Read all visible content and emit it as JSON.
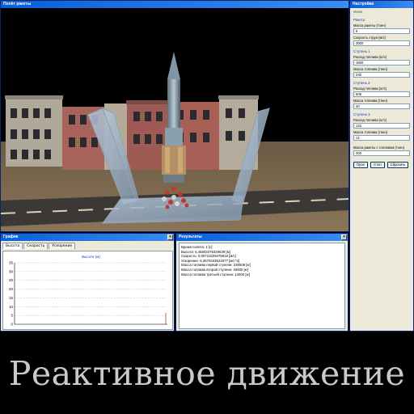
{
  "main_window": {
    "title": "Полёт ракеты"
  },
  "settings": {
    "title": "Настройки",
    "tab_label": "Меню",
    "rocket": {
      "group_title": "Ракета",
      "mass_label": "Масса ракеты (тонн)",
      "mass_value": "6",
      "exhaust_label": "Скорость струи (м/с)",
      "exhaust_value": "3000"
    },
    "stage1": {
      "group_title": "Ступень 1",
      "fuel_rate_label": "Расход топлива (кг/с)",
      "fuel_rate_value": "1600",
      "fuel_mass_label": "Масса топлива (тонн)",
      "fuel_mass_value": "240"
    },
    "stage2": {
      "group_title": "Ступень 2",
      "fuel_rate_label": "Расход топлива (кг/с)",
      "fuel_rate_value": "508",
      "fuel_mass_label": "Масса топлива (тонн)",
      "fuel_mass_value": "40"
    },
    "stage3": {
      "group_title": "Ступень 3",
      "fuel_rate_label": "Расход топлива (кг/с)",
      "fuel_rate_value": "132",
      "fuel_mass_label": "Масса топлива (тонн)",
      "fuel_mass_value": "14"
    },
    "total_mass_label": "Масса ракеты с топливом (тонн)",
    "total_mass_value": "300",
    "buttons": {
      "start": "Пуск!",
      "stop": "Стоп",
      "reset": "Сбросить"
    }
  },
  "graph_window": {
    "title": "График",
    "tabs": [
      "Высота",
      "Скорость",
      "Ускорение"
    ],
    "active_tab": 0
  },
  "chart_data": {
    "type": "line",
    "title": "Высота (м)",
    "xlabel": "",
    "ylabel": "",
    "ylim": [
      0,
      35
    ],
    "y_ticks": [
      "35",
      "30",
      "25",
      "20",
      "15",
      "10",
      "5",
      "0"
    ],
    "grid": true,
    "series": [
      {
        "values": [
          0,
          6.5
        ]
      }
    ]
  },
  "results_window": {
    "title": "Результаты",
    "lines": [
      "Время полёта: 1 [с]",
      "Высота: 6,45803375329639 [м]",
      "Скорость: 0,00721029475916 [м/с]",
      "Ускорение: 6,3570443624077 [м/с^2]",
      "Масса топлива первой ступени: 238506 [кг]",
      "Масса топлива второй ступени: 40000 [кг]",
      "Масса топлива третьей ступени: 14000 [кг]"
    ]
  },
  "caption": "Реактивное движение"
}
